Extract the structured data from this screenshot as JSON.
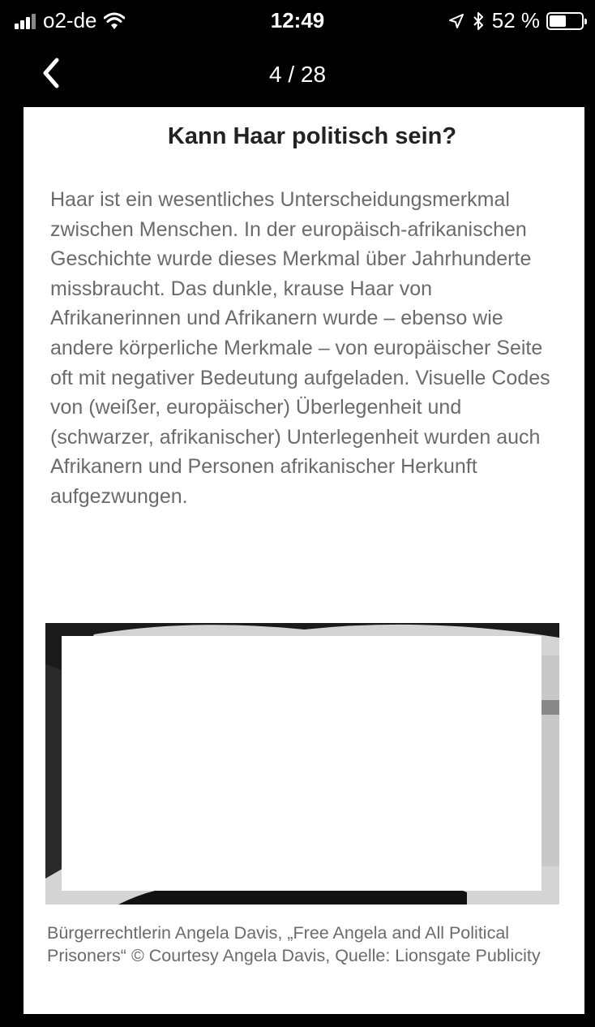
{
  "status_bar": {
    "carrier": "o2-de",
    "time": "12:49",
    "battery_percent": "52 %",
    "battery_level": 0.52,
    "icons": [
      "signal-icon",
      "wifi-icon",
      "location-arrow-icon",
      "bluetooth-icon",
      "battery-icon"
    ]
  },
  "nav": {
    "back_icon": "chevron-left-icon",
    "page_indicator": "4 / 28"
  },
  "article": {
    "title": "Kann Haar politisch sein?",
    "body": "Haar ist ein wesentliches Unterscheidungsmerkmal zwischen Menschen. In der europäisch-afrikanischen Geschichte wurde dieses Merkmal über Jahrhunderte missbraucht. Das dunkle, krause Haar von Afrikanerinnen und Afrikanern wurde – ebenso wie andere körperliche Merkmale – von europäischer Seite oft mit negativer Bedeutung aufgeladen. Visuelle Codes von (weißer, europäischer) Überlegenheit und (schwarzer, afrikanischer) Unterlegenheit wurden auch Afrikanern und Personen afrikanischer Herkunft aufgezwungen.",
    "caption": "Bürgerrechtlerin Angela Davis, „Free Angela and All Political Prisoners“ © Courtesy Angela Davis, Quelle: Lionsgate Publicity"
  },
  "colors": {
    "background": "#000000",
    "card": "#ffffff",
    "title_text": "#222222",
    "body_text": "#6b6b6b"
  }
}
